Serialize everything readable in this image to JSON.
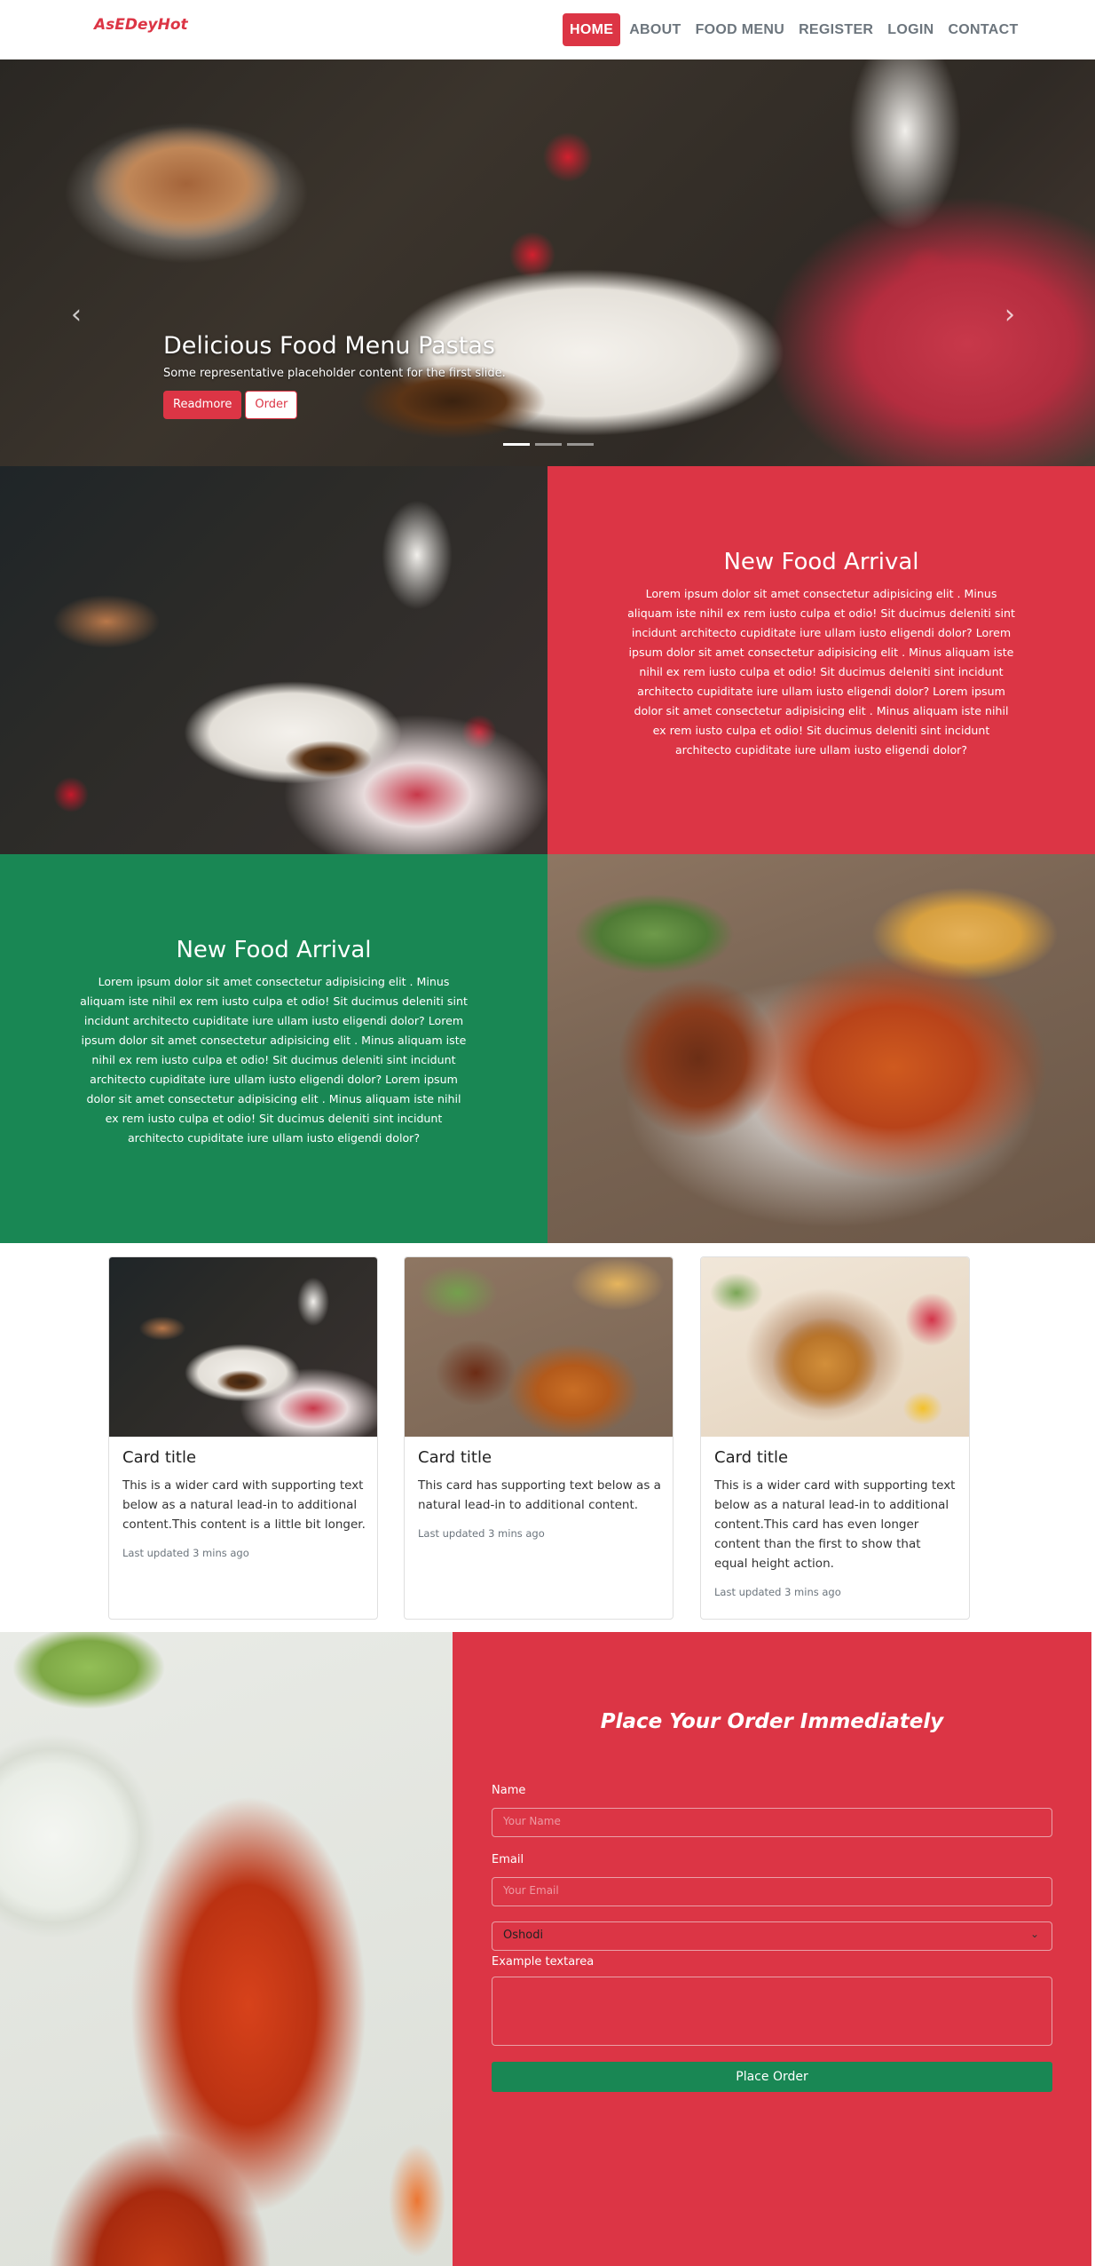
{
  "nav": {
    "brand": "AsEDeyHot",
    "links": [
      "HOME",
      "ABOUT",
      "FOOD MENU",
      "REGISTER",
      "LOGIN",
      "CONTACT"
    ]
  },
  "hero": {
    "title": "Delicious Food Menu Pastas",
    "subtitle": "Some representative placeholder content for the first slide.",
    "readmore": "Readmore",
    "order": "Order",
    "prev_icon": "‹",
    "next_icon": "›"
  },
  "feature1": {
    "title": "New Food Arrival",
    "text": "Lorem ipsum dolor sit amet consectetur adipisicing elit . Minus aliquam iste nihil ex rem iusto culpa et odio! Sit ducimus deleniti sint incidunt architecto cupiditate iure ullam iusto eligendi dolor? Lorem ipsum dolor sit amet consectetur adipisicing elit . Minus aliquam iste nihil ex rem iusto culpa et odio! Sit ducimus deleniti sint incidunt architecto cupiditate iure ullam iusto eligendi dolor? Lorem ipsum dolor sit amet consectetur adipisicing elit . Minus aliquam iste nihil ex rem iusto culpa et odio! Sit ducimus deleniti sint incidunt architecto cupiditate iure ullam iusto eligendi dolor?"
  },
  "feature2": {
    "title": "New Food Arrival",
    "text": "Lorem ipsum dolor sit amet consectetur adipisicing elit . Minus aliquam iste nihil ex rem iusto culpa et odio! Sit ducimus deleniti sint incidunt architecto cupiditate iure ullam iusto eligendi dolor? Lorem ipsum dolor sit amet consectetur adipisicing elit . Minus aliquam iste nihil ex rem iusto culpa et odio! Sit ducimus deleniti sint incidunt architecto cupiditate iure ullam iusto eligendi dolor? Lorem ipsum dolor sit amet consectetur adipisicing elit . Minus aliquam iste nihil ex rem iusto culpa et odio! Sit ducimus deleniti sint incidunt architecto cupiditate iure ullam iusto eligendi dolor?"
  },
  "cards": [
    {
      "title": "Card title",
      "text": "This is a wider card with supporting text below as a natural lead-in to additional content.This content is a little bit longer.",
      "updated": "Last updated 3 mins ago"
    },
    {
      "title": "Card title",
      "text": "This card has supporting text below as a natural lead-in to additional content.",
      "updated": "Last updated 3 mins ago"
    },
    {
      "title": "Card title",
      "text": "This is a wider card with supporting text below as a natural lead-in to additional content.This card has even longer content than the first to show that equal height action.",
      "updated": "Last updated 3 mins ago"
    }
  ],
  "order": {
    "title": "Place Your Order Immediately",
    "name_label": "Name",
    "name_placeholder": "Your Name",
    "email_label": "Email",
    "email_placeholder": "Your Email",
    "select_value": "Oshodi",
    "textarea_label": "Example textarea",
    "submit": "Place Order"
  },
  "colors": {
    "brand_red": "#dc3545",
    "brand_green": "#198754"
  }
}
